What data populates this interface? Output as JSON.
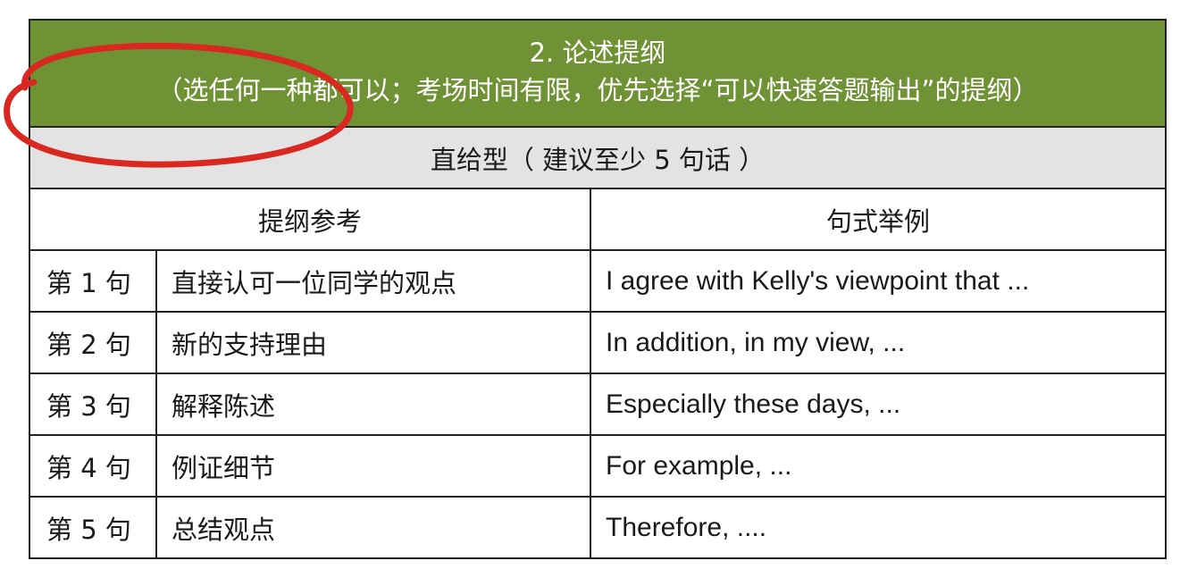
{
  "header": {
    "title": "2. 论述提纲",
    "subtitle": "（选任何一种都可以；考场时间有限，优先选择“可以快速答题输出”的提纲）"
  },
  "outline_type": "直给型（ 建议至少 5 句话 ）",
  "columns": {
    "reference": "提纲参考",
    "example": "句式举例"
  },
  "rows": [
    {
      "num": "第 1 句",
      "desc": "直接认可一位同学的观点",
      "example": "I agree with Kelly's viewpoint that ..."
    },
    {
      "num": "第 2 句",
      "desc": "新的支持理由",
      "example": "In addition, in my view, ..."
    },
    {
      "num": "第 3 句",
      "desc": "解释陈述",
      "example": "Especially these days, ..."
    },
    {
      "num": "第 4 句",
      "desc": "例证细节",
      "example": "For example, ..."
    },
    {
      "num": "第 5 句",
      "desc": "总结观点",
      "example": "Therefore, ...."
    }
  ],
  "colors": {
    "header_bg": "#6f9334",
    "subheader_bg": "#e3e3e3",
    "annotation_red": "#d9281f"
  }
}
